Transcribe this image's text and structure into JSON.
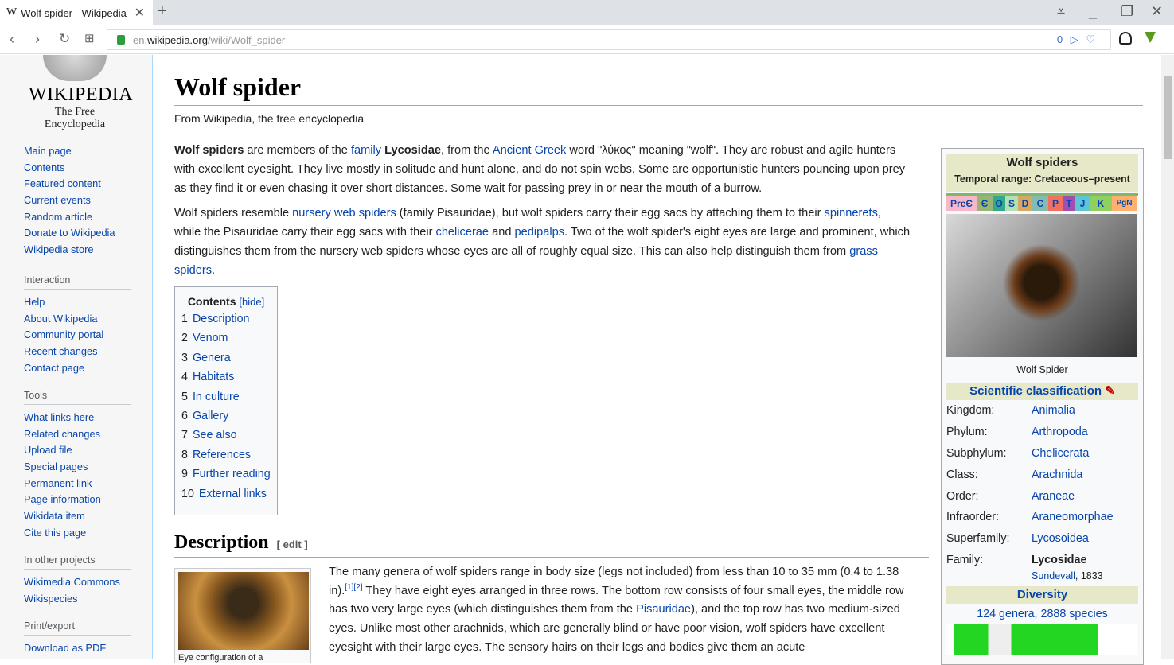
{
  "browser": {
    "tab_title": "Wolf spider - Wikipedia",
    "tab_favicon": "W",
    "url_sub": "en.",
    "url_domain": "wikipedia.org",
    "url_path": "/wiki/Wolf_spider",
    "url_badges": "0 ▷ ♡"
  },
  "sidebar": {
    "wordmark": "WIKIPEDIA",
    "tagline": "The Free Encyclopedia",
    "nav": [
      "Main page",
      "Contents",
      "Featured content",
      "Current events",
      "Random article",
      "Donate to Wikipedia",
      "Wikipedia store"
    ],
    "interaction": {
      "title": "Interaction",
      "items": [
        "Help",
        "About Wikipedia",
        "Community portal",
        "Recent changes",
        "Contact page"
      ]
    },
    "tools": {
      "title": "Tools",
      "items": [
        "What links here",
        "Related changes",
        "Upload file",
        "Special pages",
        "Permanent link",
        "Page information",
        "Wikidata item",
        "Cite this page"
      ]
    },
    "projects": {
      "title": "In other projects",
      "items": [
        "Wikimedia Commons",
        "Wikispecies"
      ]
    },
    "print": {
      "title": "Print/export",
      "items": [
        "Download as PDF"
      ]
    }
  },
  "article": {
    "title": "Wolf spider",
    "tagline": "From Wikipedia, the free encyclopedia",
    "toc": {
      "title": "Contents",
      "hide": "[hide]",
      "items": [
        {
          "n": "1",
          "label": "Description"
        },
        {
          "n": "2",
          "label": "Venom"
        },
        {
          "n": "3",
          "label": "Genera"
        },
        {
          "n": "4",
          "label": "Habitats"
        },
        {
          "n": "5",
          "label": "In culture"
        },
        {
          "n": "6",
          "label": "Gallery"
        },
        {
          "n": "7",
          "label": "See also"
        },
        {
          "n": "8",
          "label": "References"
        },
        {
          "n": "9",
          "label": "Further reading"
        },
        {
          "n": "10",
          "label": "External links"
        }
      ]
    },
    "section1": {
      "heading": "Description",
      "edit": "[ edit ]",
      "thumb_caption": "Eye configuration of a"
    }
  },
  "infobox": {
    "title": "Wolf spiders",
    "range": "Temporal range: Cretaceous–present",
    "periods": [
      "PreЄ",
      "Є",
      "O",
      "S",
      "D",
      "C",
      "P",
      "T",
      "J",
      "K",
      "PgN"
    ],
    "period_colors": [
      "#f74370",
      "#7fa056",
      "#009270",
      "#b3e1b6",
      "#cb8c37",
      "#67a599",
      "#f04028",
      "#812b92",
      "#34b2c9",
      "#7fc64e",
      "#fd9a52"
    ],
    "image_caption": "Wolf Spider",
    "classification_title": "Scientific classification",
    "ranks": [
      {
        "k": "Kingdom:",
        "v": "Animalia"
      },
      {
        "k": "Phylum:",
        "v": "Arthropoda"
      },
      {
        "k": "Subphylum:",
        "v": "Chelicerata"
      },
      {
        "k": "Class:",
        "v": "Arachnida"
      },
      {
        "k": "Order:",
        "v": "Araneae"
      },
      {
        "k": "Infraorder:",
        "v": "Araneomorphae"
      },
      {
        "k": "Superfamily:",
        "v": "Lycosoidea"
      },
      {
        "k": "Family:",
        "v": "Lycosidae"
      }
    ],
    "family_author": "Sundevall",
    "family_year": ", 1833",
    "diversity_title": "Diversity",
    "diversity": "124 genera, 2888 species"
  }
}
